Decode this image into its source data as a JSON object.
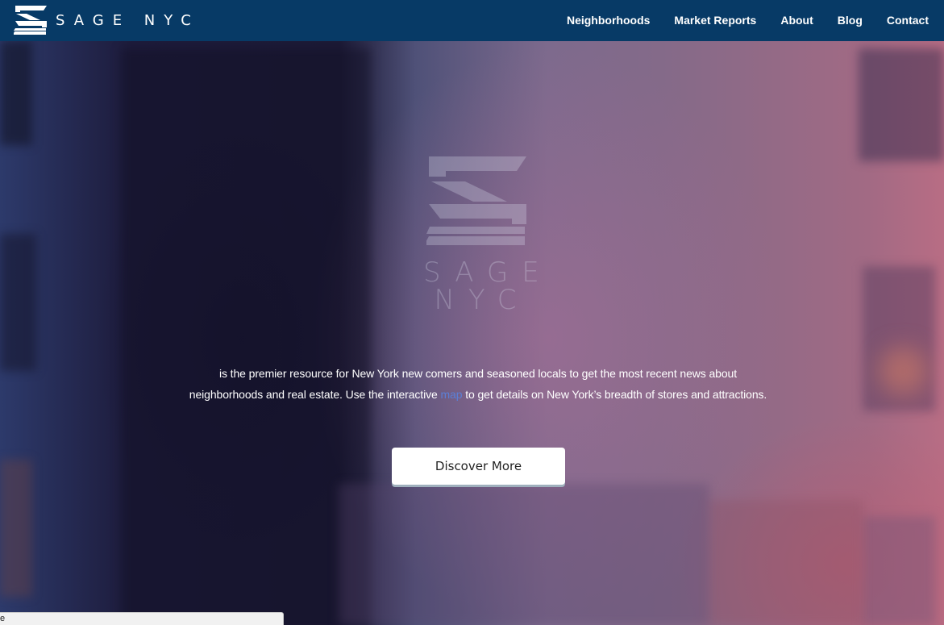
{
  "app": {
    "brand_name": "SAGE NYC",
    "brand_icon": "sage-nyc-logo-icon"
  },
  "nav": {
    "items": [
      {
        "label": "Neighborhoods"
      },
      {
        "label": "Market Reports"
      },
      {
        "label": "About"
      },
      {
        "label": "Blog"
      },
      {
        "label": "Contact"
      }
    ]
  },
  "hero": {
    "logo_line1": "SAGE",
    "logo_line2": "NYC",
    "description_line1": "is the premier resource for New York new comers and seasoned locals to get the most recent news about",
    "description_line2_before": "neighborhoods and real estate. Use the interactive ",
    "map_link": "map",
    "description_line2_after": " to get details on New York’s breadth of stores and attractions.",
    "button_label": "Discover More"
  },
  "status_bar": {
    "text": "e"
  },
  "colors": {
    "navbar": "#073a66",
    "link_accent": "#5b7fd6",
    "button_bg": "#ffffff",
    "button_shadow": "#9fb0bd"
  }
}
